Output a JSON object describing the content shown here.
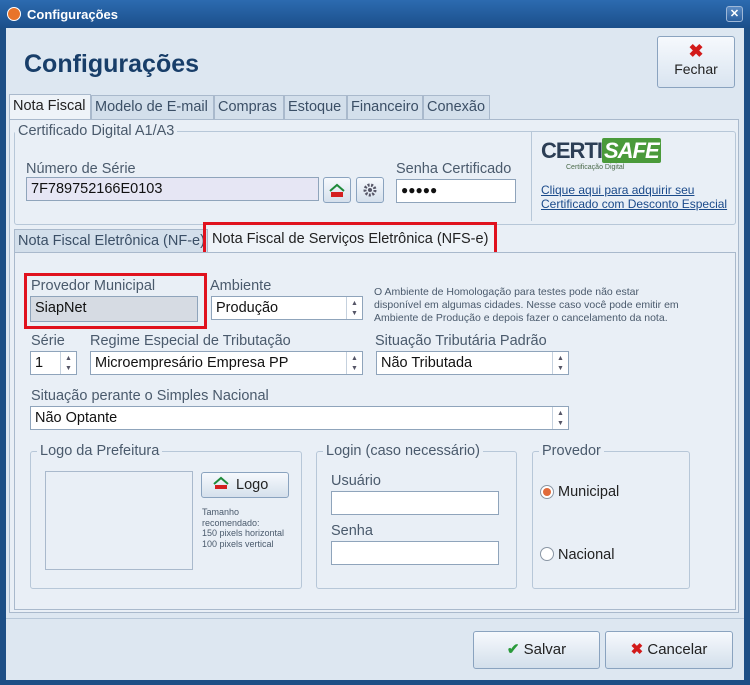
{
  "window": {
    "title": "Configurações"
  },
  "header": {
    "title": "Configurações",
    "close_label": "Fechar"
  },
  "tabs": [
    "Nota Fiscal",
    "Modelo de E-mail",
    "Compras",
    "Estoque",
    "Financeiro",
    "Conexão"
  ],
  "certificate": {
    "group_label": "Certificado Digital A1/A3",
    "serial_label": "Número de Série",
    "serial_value": "7F789752166E0103",
    "password_label": "Senha Certificado",
    "password_value": "●●●●●",
    "brand_left": "CERTI",
    "brand_right": "SAFE",
    "brand_sub": "Certificação Digital",
    "link_line1": "Clique aqui para adquirir seu",
    "link_line2": "Certificado com Desconto Especial"
  },
  "subtabs": [
    "Nota Fiscal Eletrônica (NF-e)",
    "Nota Fiscal de Serviços Eletrônica (NFS-e)"
  ],
  "nfse": {
    "provider_label": "Provedor Municipal",
    "provider_value": "SiapNet",
    "environment_label": "Ambiente",
    "environment_value": "Produção",
    "note_line1": "O Ambiente de Homologação para testes pode não estar",
    "note_line2": "disponível em algumas cidades. Nesse caso você pode emitir em",
    "note_line3": "Ambiente de Produção e depois fazer o cancelamento da nota.",
    "series_label": "Série",
    "series_value": "1",
    "regime_label": "Regime Especial de Tributação",
    "regime_value": "Microempresário Empresa PP",
    "tax_label": "Situação Tributária Padrão",
    "tax_value": "Não Tributada",
    "simples_label": "Situação perante o Simples Nacional",
    "simples_value": "Não Optante",
    "logo_group": "Logo da Prefeitura",
    "logo_button": "Logo",
    "logo_hint1": "Tamanho",
    "logo_hint2": "recomendado:",
    "logo_hint3": "150 pixels horizontal",
    "logo_hint4": "100 pixels vertical",
    "login_group": "Login (caso necessário)",
    "user_label": "Usuário",
    "pass_label": "Senha",
    "provider_group": "Provedor",
    "radio_municipal": "Municipal",
    "radio_nacional": "Nacional",
    "selected_provider": "Municipal"
  },
  "footer": {
    "save": "Salvar",
    "cancel": "Cancelar"
  },
  "colors": {
    "accent": "#183e69",
    "highlight": "#e0121e",
    "titlebar": "#1d4f86"
  }
}
